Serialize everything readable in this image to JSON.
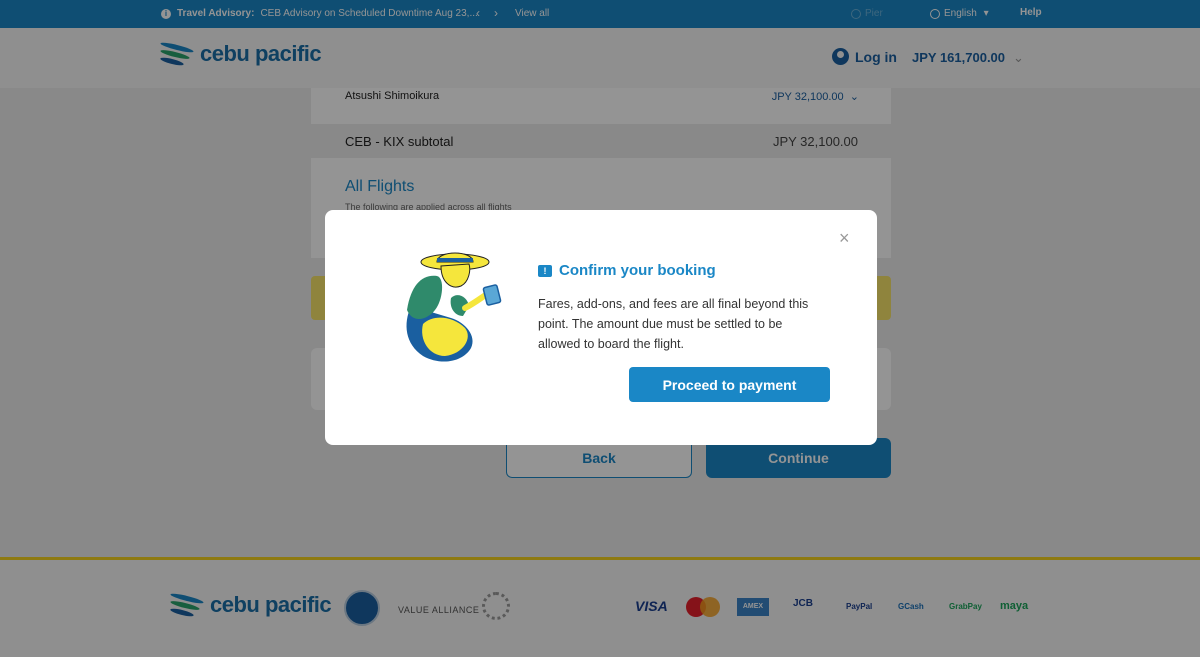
{
  "advisory": {
    "label": "Travel Advisory:",
    "text": "CEB Advisory on Scheduled Downtime Aug 23,...",
    "prev": "‹",
    "next": "›",
    "view_all": "View all"
  },
  "topbar": {
    "flight_status": "Pier",
    "language": "English",
    "help": "Help"
  },
  "header": {
    "logo_text": "cebu pacific",
    "login": "Log in",
    "total_price": "JPY 161,700.00"
  },
  "summary": {
    "passenger_name": "Atsushi Shimoikura",
    "passenger_price": "JPY 32,100.00",
    "subtotal_label": "CEB - KIX subtotal",
    "subtotal_value": "JPY 32,100.00",
    "all_flights_title": "All Flights",
    "all_flights_sub": "The following are applied across all flights"
  },
  "buttons": {
    "back": "Back",
    "continue": "Continue"
  },
  "footer": {
    "logo_text": "cebu pacific",
    "value_alliance": "VALUE ALLIANCE",
    "payments": [
      "VISA",
      "Mastercard",
      "AMEX",
      "JCB",
      "PayPal",
      "GCash",
      "GrabPay",
      "maya"
    ]
  },
  "modal": {
    "title": "Confirm your booking",
    "body": "Fares, add-ons, and fees are all final beyond this point. The amount due must be settled to be allowed to board the flight.",
    "proceed": "Proceed to payment",
    "close": "×"
  },
  "colors": {
    "brand_blue": "#1a87c6",
    "dark_blue": "#1a5fa0",
    "yellow": "#f4d21e"
  }
}
